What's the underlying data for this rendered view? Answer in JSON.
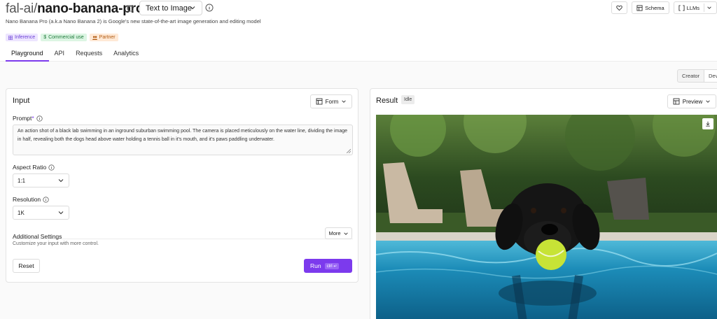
{
  "header": {
    "org": "fal-ai/",
    "model": "nano-banana-pro",
    "mode_select": "Text to Image",
    "subtitle": "Nano Banana Pro (a.k.a Nano Banana 2) is Google's new state-of-the-art image generation and editing model",
    "badges": [
      {
        "label": "Inference",
        "icon": "grid-icon"
      },
      {
        "label": "Commercial use",
        "icon": "dollar-icon"
      },
      {
        "label": "Partner",
        "icon": "people-icon"
      }
    ],
    "actions": {
      "schema": "Schema",
      "llms": "LLMs"
    }
  },
  "tabs": [
    "Playground",
    "API",
    "Requests",
    "Analytics"
  ],
  "active_tab": "Playground",
  "view_toggle": {
    "creator": "Creator",
    "dev": "Dev"
  },
  "input_panel": {
    "title": "Input",
    "form_button": "Form",
    "prompt_label": "Prompt",
    "prompt_required": "*",
    "prompt_value": "An action shot of a black lab swimming in an inground suburban swimming pool. The camera is placed meticulously on the water line, dividing the image in half, revealing both the dogs head above water holding a tennis ball in it's mouth, and it's paws paddling underwater.",
    "aspect_ratio_label": "Aspect Ratio",
    "aspect_ratio_value": "1:1",
    "resolution_label": "Resolution",
    "resolution_value": "1K",
    "additional_settings_title": "Additional Settings",
    "more_button": "More",
    "additional_settings_desc": "Customize your input with more control.",
    "reset_button": "Reset",
    "run_button": "Run",
    "run_shortcut": "ctrl ↵"
  },
  "result_panel": {
    "title": "Result",
    "status": "Idle",
    "preview_button": "Preview"
  },
  "colors": {
    "accent": "#7c3aed",
    "border": "#dcdcdc"
  }
}
